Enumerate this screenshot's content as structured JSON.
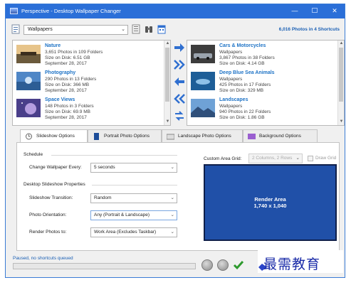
{
  "window": {
    "title": "Perspective - Desktop Wallpaper Changer",
    "controls": {
      "minimize": "—",
      "maximize": "",
      "close": "✕"
    }
  },
  "toolbar": {
    "shortcut_value": "Wallpapers",
    "photos_summary": "6,016 Photos in 4 Shortcuts",
    "icons": [
      "page-icon",
      "notes-icon",
      "binoculars-icon",
      "calendar-icon"
    ]
  },
  "left_list": [
    {
      "name": "Nature",
      "photos": "3,651 Photos in 109 Folders",
      "size": "Size on Disk: 6.51 GB",
      "date": "September 28, 2017"
    },
    {
      "name": "Photography",
      "photos": "290 Photos in 13 Folders",
      "size": "Size on Disk: 366 MB",
      "date": "September 28, 2017"
    },
    {
      "name": "Space Views",
      "photos": "148 Photos in 3 Folders",
      "size": "Size on Disk: 69.9 MB",
      "date": "September 28, 2017"
    }
  ],
  "right_list": [
    {
      "name": "Cars & Motorcycles",
      "collection": "Wallpapers",
      "photos": "3,867 Photos in 38 Folders",
      "size": "Size on Disk: 4.14 GB"
    },
    {
      "name": "Deep Blue Sea Animals",
      "collection": "Wallpapers",
      "photos": "425 Photos in 17 Folders",
      "size": "Size on Disk: 329 MB"
    },
    {
      "name": "Landscapes",
      "collection": "Wallpapers",
      "photos": "940 Photos in 22 Folders",
      "size": "Size on Disk: 1.86 GB"
    }
  ],
  "tabs": [
    {
      "label": "Slideshow Options",
      "icon": "slideshow-icon",
      "active": true
    },
    {
      "label": "Portrait Photo Options",
      "icon": "portrait-icon",
      "active": false
    },
    {
      "label": "Landscape Photo Options",
      "icon": "landscape-icon",
      "active": false
    },
    {
      "label": "Background Options",
      "icon": "background-icon",
      "active": false
    }
  ],
  "schedule": {
    "heading": "Schedule",
    "change_label": "Change Wallpaper Every:",
    "change_value": "5 seconds"
  },
  "slideshow": {
    "heading": "Desktop Slideshow Properties",
    "transition_label": "Slideshow Transition:",
    "transition_value": "Random",
    "orientation_label": "Photo Orientation:",
    "orientation_value": "Any (Portrait & Landscape)",
    "render_label": "Render Photos to:",
    "render_value": "Work Area (Excludes Taskbar)"
  },
  "custom_grid": {
    "label": "Custom Area Grid:",
    "value": "2 Columns, 2 Rows",
    "draw_grid_label": "Draw Grid",
    "draw_grid_checked": false
  },
  "render_area": {
    "title": "Render Area",
    "size": "1,740 x 1,040",
    "color": "#2050a8"
  },
  "status": {
    "text": "Paused, no shortcuts queued",
    "progress": 0
  },
  "watermark": {
    "text": "最需教育"
  },
  "colors": {
    "title_bar": "#2b6fd8",
    "accent_text": "#1e73c6",
    "arrow_blue": "#2f6fd0"
  }
}
